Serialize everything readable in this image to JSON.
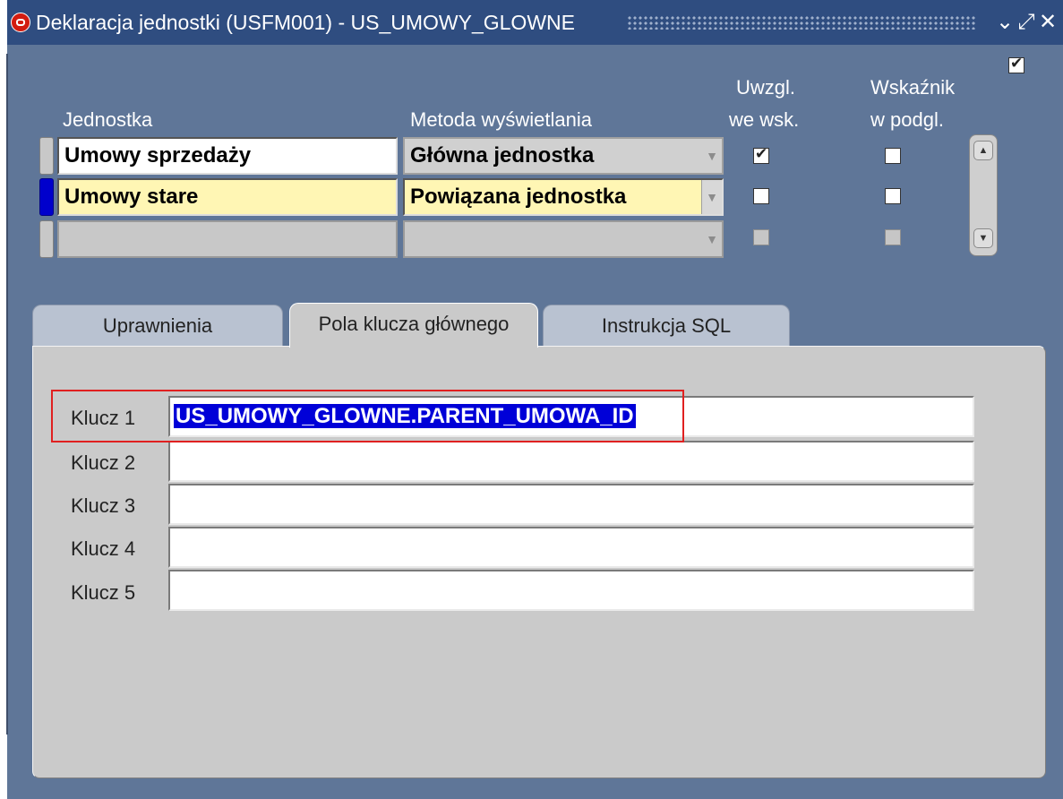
{
  "window": {
    "title": "Deklaracja jednostki (USFM001) - US_UMOWY_GLOWNE",
    "controls": {
      "minimize": "⌄",
      "maximize": "⤢",
      "close": "✕"
    }
  },
  "header_checkbox": {
    "checked": true
  },
  "columns": {
    "unit": "Jednostka",
    "method": "Metoda wyświetlania",
    "include_line1": "Uwzgl.",
    "include_line2": "we wsk.",
    "indicator_line1": "Wskaźnik",
    "indicator_line2": "w podgl."
  },
  "rows": [
    {
      "unit": "Umowy sprzedaży",
      "method": "Główna jednostka",
      "include": true,
      "indicator": false,
      "state": "normal"
    },
    {
      "unit": "Umowy stare",
      "method": "Powiązana jednostka",
      "include": false,
      "indicator": false,
      "state": "current"
    },
    {
      "unit": "",
      "method": "",
      "include": false,
      "indicator": false,
      "state": "empty"
    }
  ],
  "tabs": [
    {
      "label": "Uprawnienia",
      "active": false
    },
    {
      "label": "Pola klucza głównego",
      "active": true
    },
    {
      "label": "Instrukcja SQL",
      "active": false
    }
  ],
  "keys": [
    {
      "label": "Klucz 1",
      "value": "US_UMOWY_GLOWNE.PARENT_UMOWA_ID",
      "selected": true
    },
    {
      "label": "Klucz 2",
      "value": ""
    },
    {
      "label": "Klucz 3",
      "value": ""
    },
    {
      "label": "Klucz 4",
      "value": ""
    },
    {
      "label": "Klucz 5",
      "value": ""
    }
  ],
  "colors": {
    "background": "#5f7698",
    "titlebar": "#2f4d80",
    "current_row": "#fff6b4",
    "selection": "#0000d8",
    "highlight_box": "#e02020"
  },
  "icons": {
    "app": "oracle-icon",
    "scroll_up": "arrow-up-icon",
    "scroll_down": "arrow-down-icon"
  }
}
